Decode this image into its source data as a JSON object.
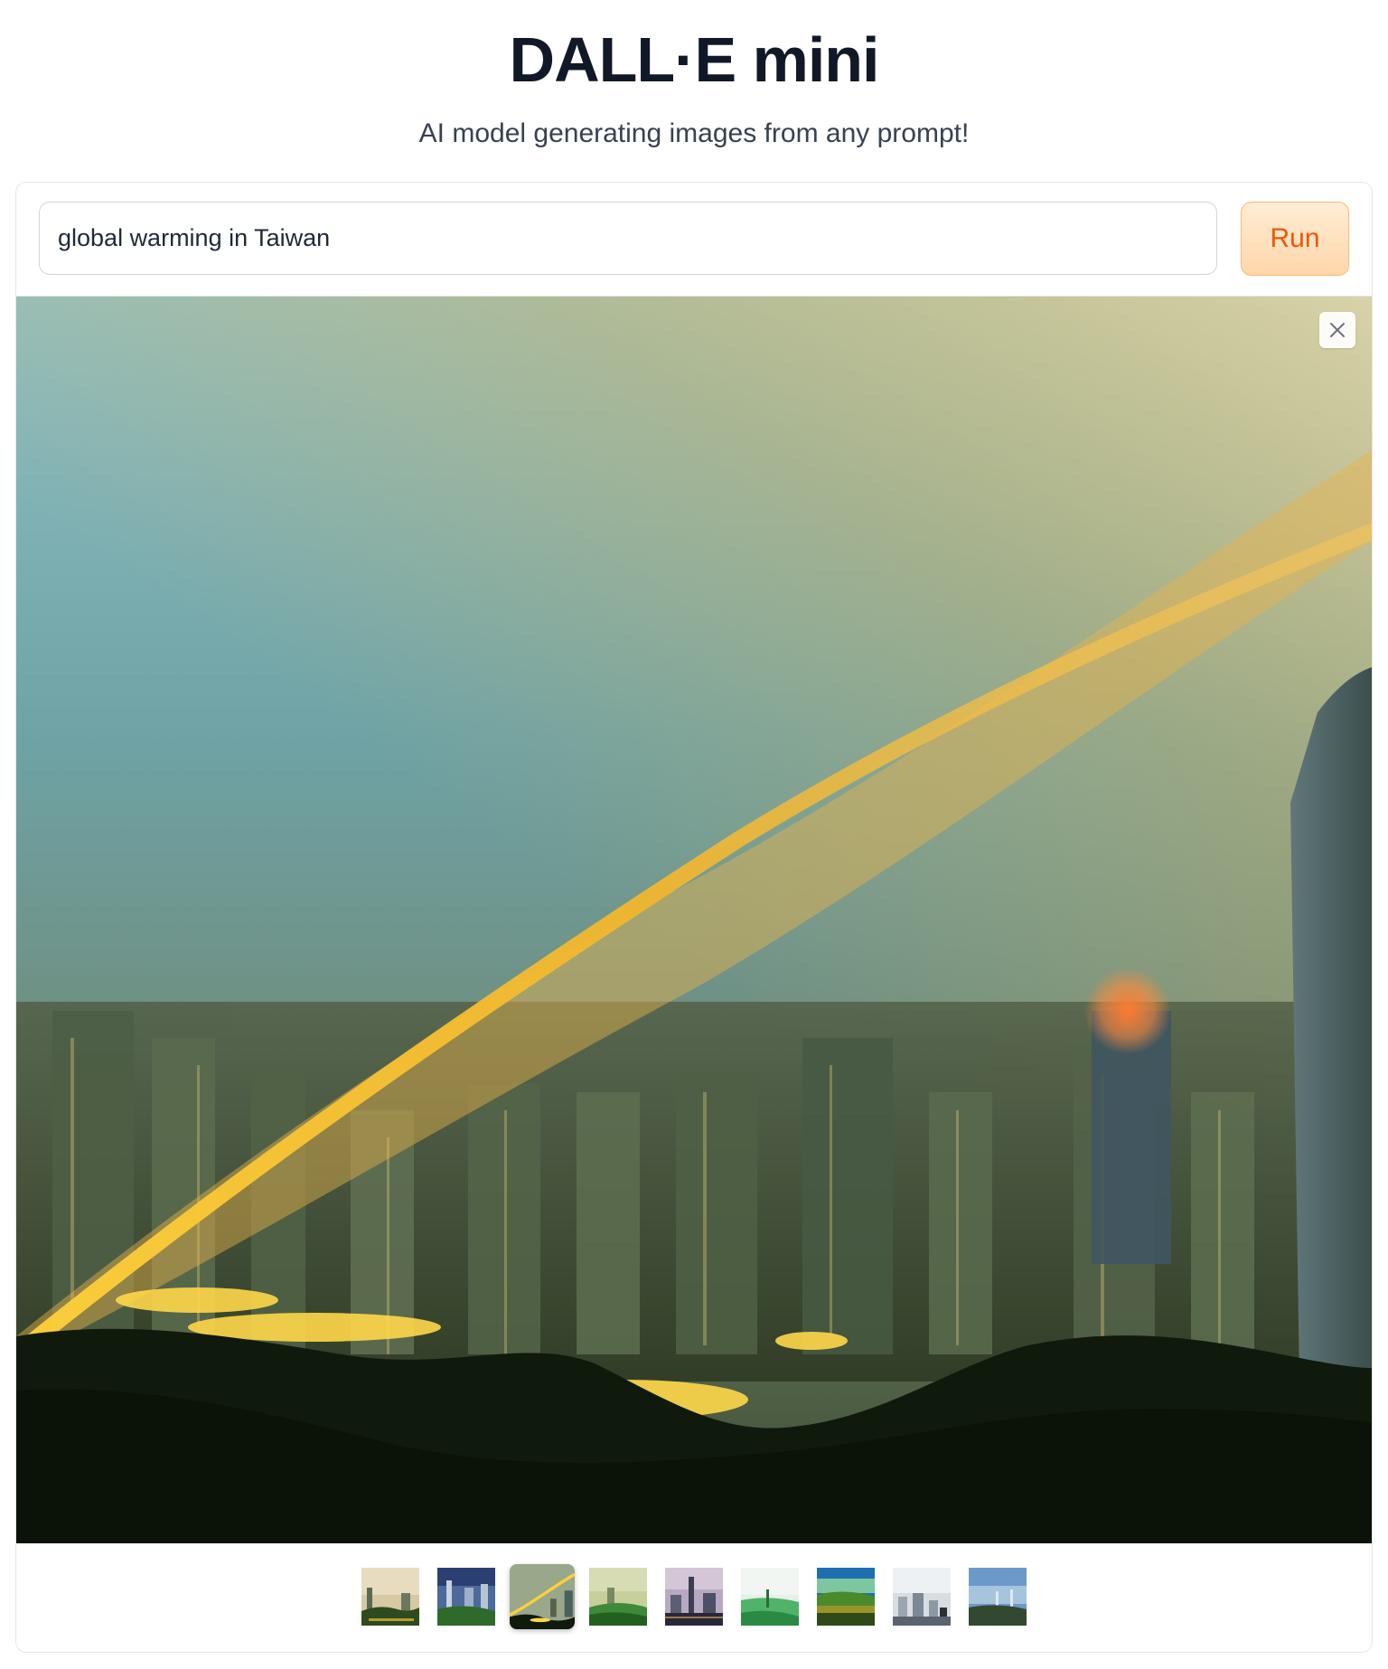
{
  "header": {
    "title": "DALL·E mini",
    "subtitle": "AI model generating images from any prompt!"
  },
  "prompt": {
    "value": "global warming in Taiwan"
  },
  "run_button": {
    "label": "Run"
  },
  "gallery": {
    "selected_index": 2,
    "thumbnail_count": 9
  },
  "colors": {
    "accent": "#ea580c",
    "run_bg": "#fed7aa"
  },
  "icons": {
    "close": "close-icon"
  }
}
